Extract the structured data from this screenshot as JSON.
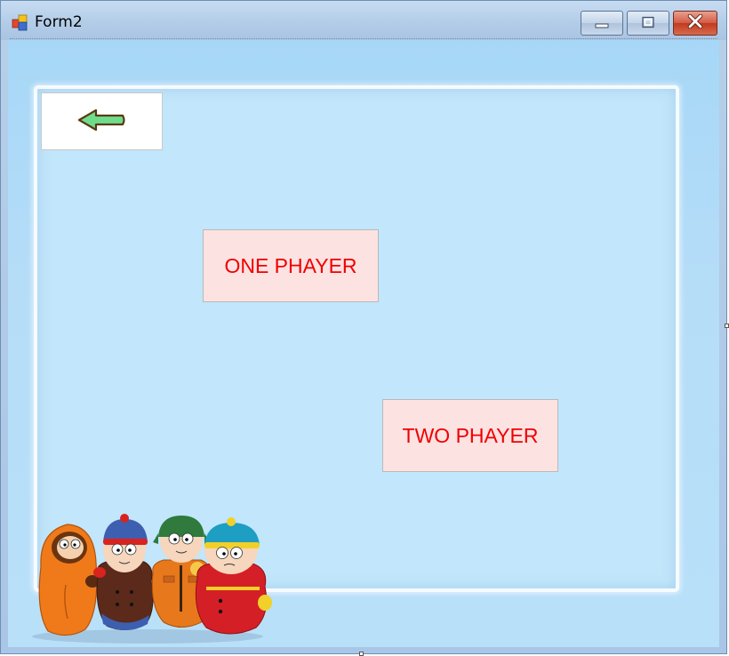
{
  "window": {
    "title": "Form2"
  },
  "titlebar": {
    "icons": [
      "app-icon",
      "minimize-icon",
      "maximize-icon",
      "close-icon"
    ]
  },
  "back_button": {
    "icon": "left-arrow-icon"
  },
  "menu": {
    "one_player_label": "ONE PHAYER",
    "two_player_label": "TWO PHAYER"
  },
  "colors": {
    "client_background": "#b5ddf8",
    "button_background": "#fde2e2",
    "button_text": "#f00000",
    "arrow_fill": "#6fdc8c",
    "arrow_outline": "#5a3a12"
  }
}
